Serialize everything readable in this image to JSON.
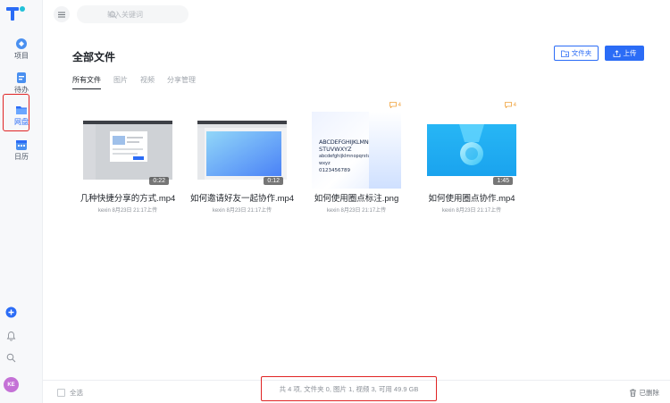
{
  "sidebar": {
    "items": [
      {
        "label": "项目",
        "icon": "project-icon"
      },
      {
        "label": "待办",
        "icon": "todo-icon"
      },
      {
        "label": "网盘",
        "icon": "netdisk-icon",
        "active": true
      },
      {
        "label": "日历",
        "icon": "calendar-icon"
      }
    ],
    "avatar_initials": "KE"
  },
  "search": {
    "placeholder": "输入关键词"
  },
  "header": {
    "title": "全部文件",
    "new_folder_label": "文件夹",
    "upload_label": "上传"
  },
  "tabs": [
    "所有文件",
    "图片",
    "视频",
    "分享管理"
  ],
  "files": [
    {
      "name": "几种快捷分享的方式.mp4",
      "meta": "kexin 8月23日 21:17上传",
      "duration": "0:22",
      "comments": ""
    },
    {
      "name": "如何邀请好友一起协作.mp4",
      "meta": "kexin 8月23日 21:17上传",
      "duration": "0:12",
      "comments": ""
    },
    {
      "name": "如何使用圈点标注.png",
      "meta": "kexin 8月23日 21:17上传",
      "duration": "",
      "comments": "4",
      "preview_lines": [
        "ABCDEFGHIJKLMNOPQR",
        "STUVWXYZ",
        "abcdefghijklmnopqrstuv",
        "wxyz",
        "0123456789"
      ]
    },
    {
      "name": "如何使用圈点协作.mp4",
      "meta": "kexin 8月23日 21:17上传",
      "duration": "1:45",
      "comments": "4"
    }
  ],
  "footer": {
    "select_all_label": "全选",
    "status_text": "共 4 项, 文件夹 0, 图片 1, 视频 3, 可用 49.9 GB",
    "deleted_label": "已删除"
  },
  "colors": {
    "accent": "#2b6cf6",
    "highlight": "#e02424",
    "comment": "#f0a23a"
  }
}
